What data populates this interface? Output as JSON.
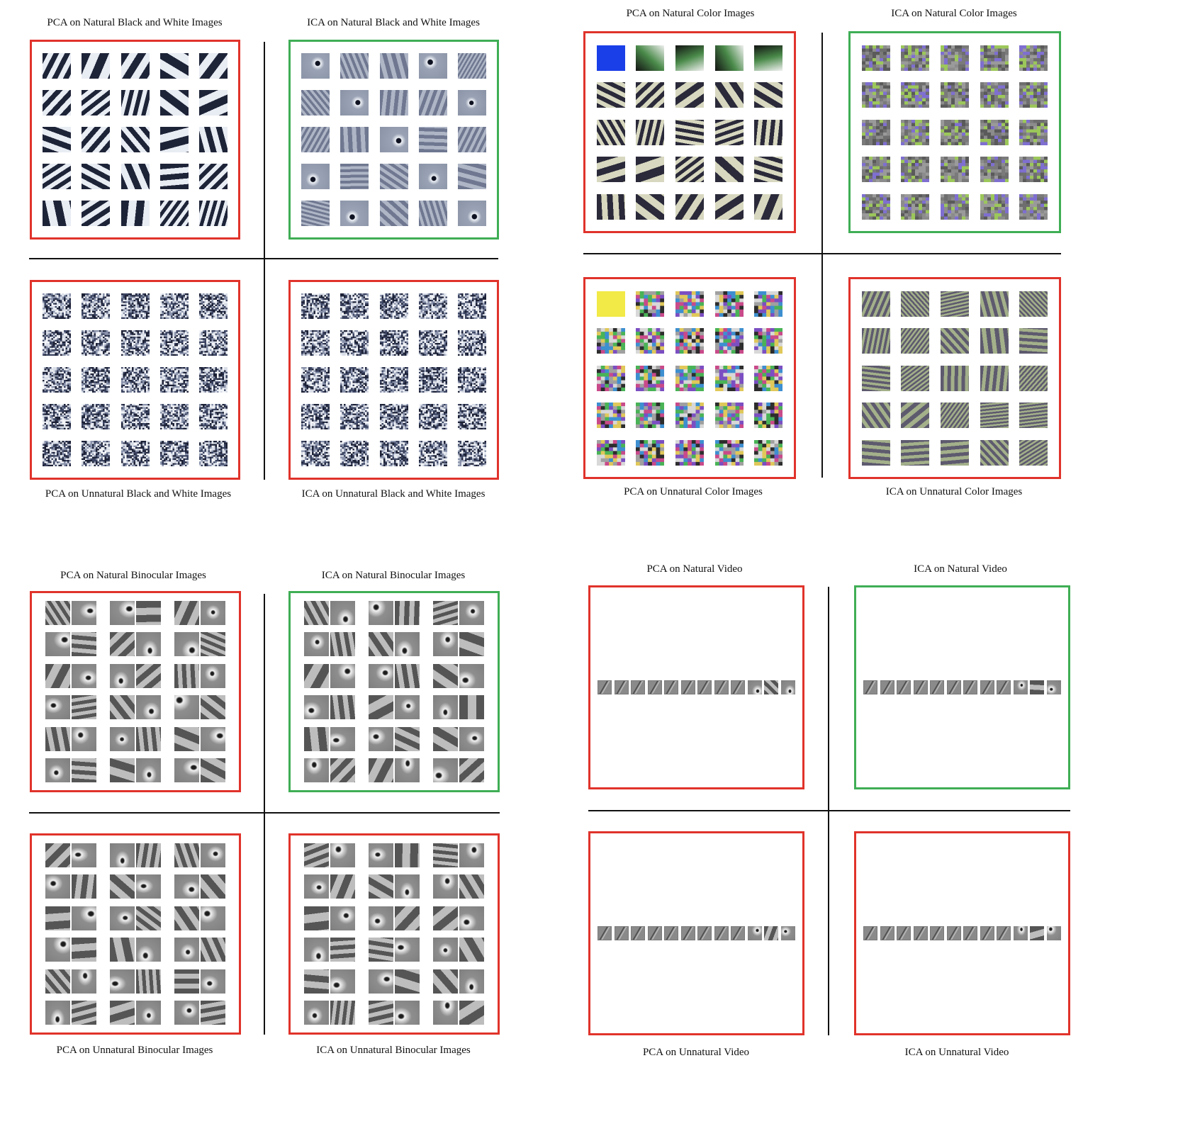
{
  "border_colors": {
    "red": "#e0332b",
    "green": "#3fae55"
  },
  "groups": [
    {
      "id": "bw",
      "kind": "grid",
      "style": "bw",
      "titles": {
        "tl": "PCA on Natural Black and White Images",
        "tr": "ICA  on Natural Black and White Images",
        "bl": "PCA on Unnatural Black and White Images",
        "br": "ICA on Unnatural Black and White Images"
      },
      "borders": {
        "tl": "red",
        "tr": "green",
        "bl": "red",
        "br": "red"
      }
    },
    {
      "id": "color",
      "kind": "grid",
      "style": "color",
      "titles": {
        "tl": "PCA on Natural Color Images",
        "tr": "ICA  on Natural Color Images",
        "bl": "PCA on Unnatural Color Images",
        "br": "ICA on Unnatural Color Images"
      },
      "borders": {
        "tl": "red",
        "tr": "green",
        "bl": "red",
        "br": "red"
      }
    },
    {
      "id": "binocular",
      "kind": "pairs",
      "style": "gray",
      "titles": {
        "tl": "PCA on Natural Binocular Images",
        "tr": "ICA  on Natural Binocular Images",
        "bl": "PCA on Unnatural Binocular Images",
        "br": "ICA on Unnatural Binocular Images"
      },
      "borders": {
        "tl": "red",
        "tr": "green",
        "bl": "red",
        "br": "red"
      }
    },
    {
      "id": "video",
      "kind": "strip",
      "style": "gray",
      "titles": {
        "tl": "PCA on Natural Video",
        "tr": "ICA  on Natural Video",
        "bl": "PCA on Unnatural Video",
        "br": "ICA on Unnatural Video"
      },
      "borders": {
        "tl": "red",
        "tr": "green",
        "bl": "red",
        "br": "red"
      }
    }
  ]
}
